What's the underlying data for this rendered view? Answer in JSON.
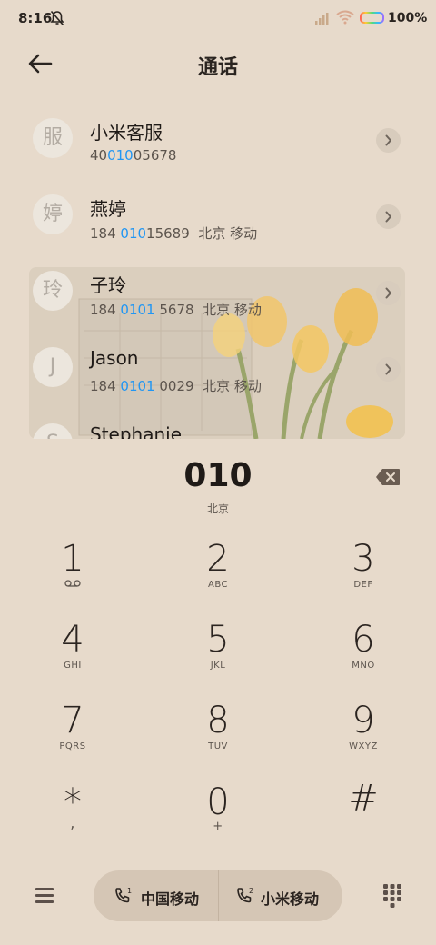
{
  "status_bar": {
    "time": "8:16",
    "battery": "100%"
  },
  "header": {
    "title": "通话"
  },
  "contacts": [
    {
      "avatar": "服",
      "name": "小米客服",
      "num_pre": "40",
      "num_hl": "010",
      "num_post": "05678",
      "location": ""
    },
    {
      "avatar": "婷",
      "name": "燕婷",
      "num_pre": "184 ",
      "num_hl": "010",
      "num_post": "15689",
      "location": "北京 移动"
    },
    {
      "avatar": "玲",
      "name": "子玲",
      "num_pre": "184 ",
      "num_hl": "0101",
      "num_post": " 5678",
      "location": "北京 移动"
    },
    {
      "avatar": "J",
      "name": "Jason",
      "num_pre": "184 ",
      "num_hl": "0101",
      "num_post": " 0029",
      "location": "北京 移动"
    },
    {
      "avatar": "S",
      "name": "Stephanie",
      "num_pre": "",
      "num_hl": "",
      "num_post": "",
      "location": ""
    }
  ],
  "dial": {
    "number": "010",
    "location": "北京"
  },
  "keypad": [
    {
      "digit": "1",
      "letters": ""
    },
    {
      "digit": "2",
      "letters": "ABC"
    },
    {
      "digit": "3",
      "letters": "DEF"
    },
    {
      "digit": "4",
      "letters": "GHI"
    },
    {
      "digit": "5",
      "letters": "JKL"
    },
    {
      "digit": "6",
      "letters": "MNO"
    },
    {
      "digit": "7",
      "letters": "PQRS"
    },
    {
      "digit": "8",
      "letters": "TUV"
    },
    {
      "digit": "9",
      "letters": "WXYZ"
    },
    {
      "digit": "*",
      "letters": ","
    },
    {
      "digit": "0",
      "letters": "+"
    },
    {
      "digit": "#",
      "letters": ""
    }
  ],
  "bottom": {
    "sim1": {
      "label": "中国移动",
      "index": "1"
    },
    "sim2": {
      "label": "小米移动",
      "index": "2"
    }
  },
  "colors": {
    "background": "#e7dacb",
    "highlight": "#2196f3",
    "pill": "#d5c6b5"
  }
}
